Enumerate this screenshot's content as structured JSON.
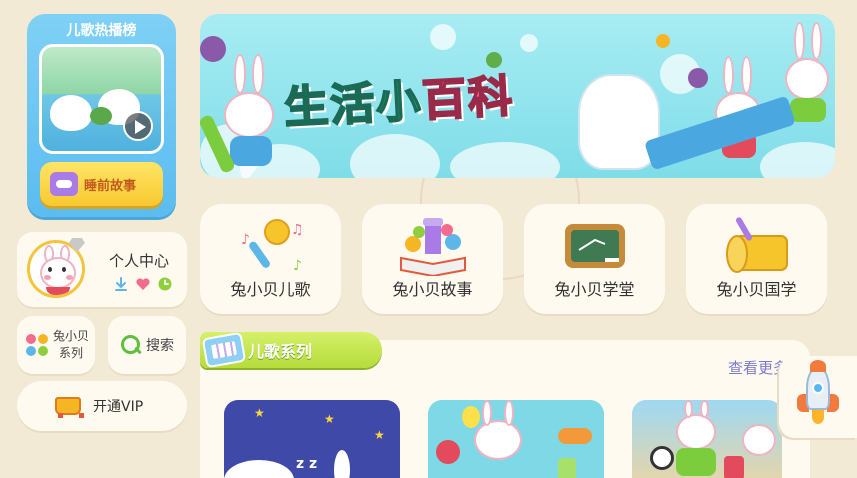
{
  "hot_list": {
    "title": "儿歌热播榜",
    "story_button": "睡前故事"
  },
  "profile": {
    "label": "个人中心",
    "icons": [
      "download-icon",
      "heart-icon",
      "history-icon"
    ]
  },
  "series_button": {
    "label_line1": "兔小贝",
    "label_line2": "系列"
  },
  "search_button": {
    "label": "搜索"
  },
  "vip_button": {
    "label": "开通VIP"
  },
  "banner": {
    "title_green": "生活小",
    "title_pink": "百科"
  },
  "categories": [
    {
      "label": "兔小贝儿歌",
      "icon": "microphone-icon"
    },
    {
      "label": "兔小贝故事",
      "icon": "storybook-icon"
    },
    {
      "label": "兔小贝学堂",
      "icon": "chalkboard-icon"
    },
    {
      "label": "兔小贝国学",
      "icon": "scroll-icon"
    }
  ],
  "song_series": {
    "title": "儿歌系列",
    "see_more": "查看更多"
  },
  "colors": {
    "background": "#f3ead6",
    "card": "#fffaf0",
    "hot_blue": "#5bbcf0",
    "story_yellow": "#f8c92f",
    "section_green": "#b5dc3b",
    "banner_cyan": "#7fdde8"
  }
}
